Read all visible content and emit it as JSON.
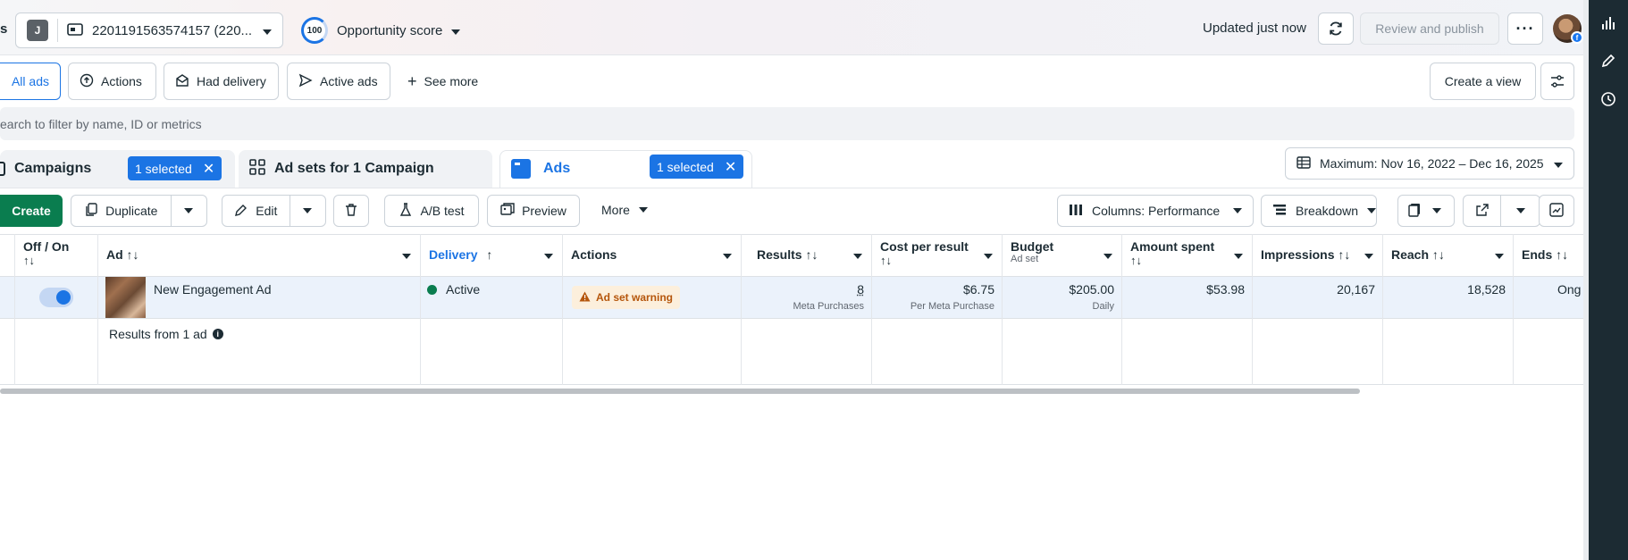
{
  "header": {
    "crumb_tail": "s",
    "account_initial": "J",
    "account_name": "2201191563574157 (220...",
    "opportunity_score_value": "100",
    "opportunity_score_label": "Opportunity score",
    "updated_text": "Updated just now",
    "review_publish_label": "Review and publish",
    "profile_badge": "f"
  },
  "filters": {
    "tabs": [
      {
        "label": "All ads",
        "active": true
      },
      {
        "label": "Actions",
        "active": false
      },
      {
        "label": "Had delivery",
        "active": false
      },
      {
        "label": "Active ads",
        "active": false
      }
    ],
    "see_more_label": "See more",
    "create_view_label": "Create a view"
  },
  "search": {
    "placeholder": "earch to filter by name, ID or metrics"
  },
  "levels": {
    "campaigns_label": "Campaigns",
    "campaigns_selected": "1 selected",
    "adsets_label": "Ad sets for 1 Campaign",
    "ads_label": "Ads",
    "ads_selected": "1 selected",
    "date_range": "Maximum: Nov 16, 2022 – Dec 16, 2025"
  },
  "toolbar": {
    "create_label": "Create",
    "duplicate_label": "Duplicate",
    "edit_label": "Edit",
    "ab_test_label": "A/B test",
    "preview_label": "Preview",
    "more_label": "More",
    "columns_label": "Columns: Performance",
    "breakdown_label": "Breakdown"
  },
  "table": {
    "headers": {
      "off_on": "Off / On",
      "sort_glyph": "↑↓",
      "ad": "Ad ↑↓",
      "delivery": "Delivery",
      "delivery_arrow": "↑",
      "actions": "Actions",
      "results": "Results ↑↓",
      "cost_per_result": "Cost per result",
      "budget": "Budget",
      "budget_sub": "Ad set",
      "amount_spent": "Amount spent",
      "impressions": "Impressions ↑↓",
      "reach": "Reach ↑↓",
      "ends": "Ends ↑↓"
    },
    "row": {
      "enabled": true,
      "ad_name": "New Engagement Ad",
      "delivery": "Active",
      "action_warning": "Ad set warning",
      "results_value": "8",
      "results_sub": "Meta Purchases",
      "cost_value": "$6.75",
      "cost_sub": "Per Meta Purchase",
      "budget_value": "$205.00",
      "budget_sub": "Daily",
      "amount_spent": "$53.98",
      "impressions": "20,167",
      "reach": "18,528",
      "ends": "Ong"
    },
    "footer": {
      "results_from": "Results from 1 ad"
    }
  },
  "colors": {
    "accent_blue": "#1b74e4",
    "create_green": "#0a7d4f",
    "active_dot": "#0a7d4f",
    "warning_text": "#b5560c",
    "rail_bg": "#1c2b33"
  }
}
